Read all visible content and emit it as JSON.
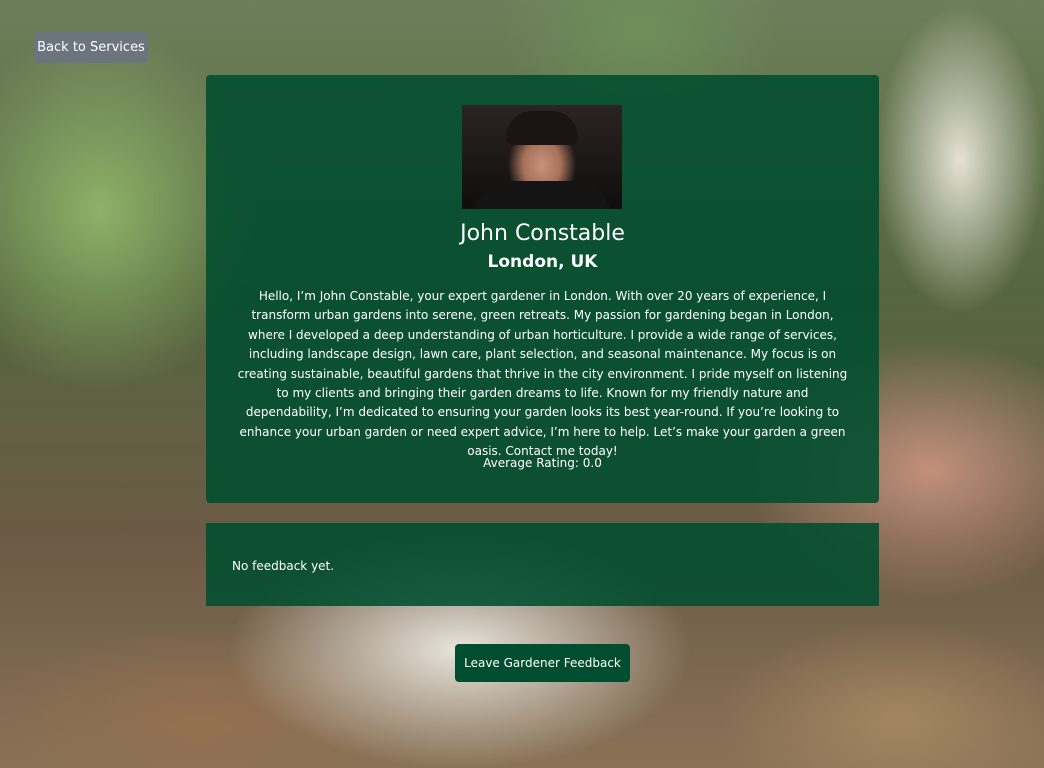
{
  "navigation": {
    "back_label": "Back to Services"
  },
  "profile": {
    "name": "John Constable",
    "location": "London, UK",
    "bio": "Hello, I’m John Constable, your expert gardener in London. With over 20 years of experience, I transform urban gardens into serene, green retreats. My passion for gardening began in London, where I developed a deep understanding of urban horticulture. I provide a wide range of services, including landscape design, lawn care, plant selection, and seasonal maintenance. My focus is on creating sustainable, beautiful gardens that thrive in the city environment. I pride myself on listening to my clients and bringing their garden dreams to life. Known for my friendly nature and dependability, I’m dedicated to ensuring your garden looks its best year-round. If you’re looking to enhance your urban garden or need expert advice, I’m here to help. Let’s make your garden a green oasis. Contact me today!",
    "rating_label": "Average Rating: 0.0"
  },
  "feedback": {
    "empty_message": "No feedback yet."
  },
  "actions": {
    "leave_feedback_label": "Leave Gardener Feedback"
  },
  "colors": {
    "card_background": "#004d2f",
    "back_button": "#6c757d",
    "text": "#ffffff"
  }
}
